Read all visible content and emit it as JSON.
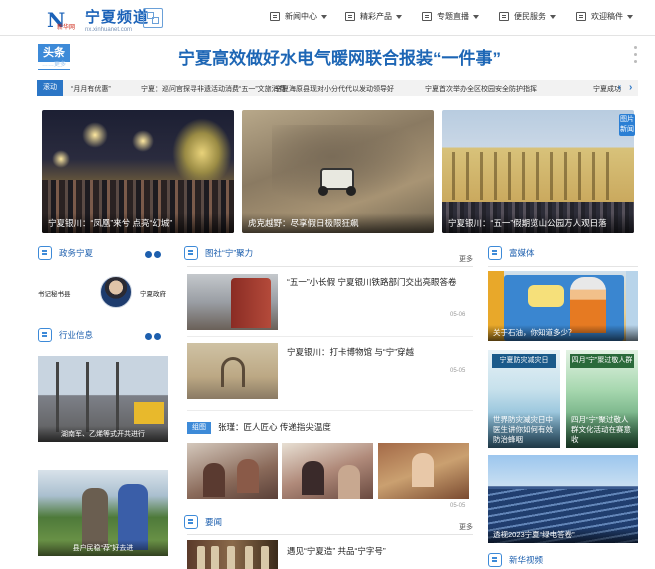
{
  "header": {
    "logo_mark": "N",
    "logo_sub": "新华网",
    "logo_title": "宁夏频道",
    "logo_url": "nx.xinhuanet.com",
    "nav": [
      {
        "label": "新闻中心"
      },
      {
        "label": "精彩产品"
      },
      {
        "label": "专题直播"
      },
      {
        "label": "便民服务"
      },
      {
        "label": "欢迎稿件"
      }
    ]
  },
  "headline": {
    "tag": "头条",
    "tag_more": "……更多",
    "title": "宁夏高效做好水电气暖网联合报装“一件事”"
  },
  "ticker": {
    "label": "滚动",
    "items": [
      "“月月有优惠”",
      "宁夏：巡问官探寻非遗活动消费“五一”文旅消费",
      "宁夏海原县现对小分代代以发动领导好",
      "宁夏首届民营企业家“感恩年”",
      "宁夏首次举办全区校园安全防护指挥",
      "宁夏成功"
    ]
  },
  "hero": [
    {
      "caption": "宁夏银川：“凤凰”来兮 点亮“幻城”"
    },
    {
      "caption": "虎克越野：尽享假日极限狂飙"
    },
    {
      "caption": "宁夏银川：“五一”假期览山公园万人观日落"
    }
  ],
  "hero_badge": "图片\n新闻",
  "left": {
    "sec1": "政务宁夏",
    "lead_left": "书记秘书县",
    "lead_right": "宁夏政府",
    "sec2": "行业信息",
    "thumb1_caption": "湖南军、乙烯等式开共进行",
    "thumb2_caption": "县户民稳“荐”好去进"
  },
  "middle": {
    "sec1": "图社“宁”聚力",
    "more": "更多",
    "news": [
      {
        "title": "“五一”小长假 宁夏银川铁路部门交出亮眼答卷",
        "date": "05-06"
      },
      {
        "title": "宁夏银川：打卡博物馆 与“宁”穿越",
        "date": "05-05"
      }
    ],
    "gallery_tag": "组图",
    "gallery_title": "张瑾：匠人匠心 传递指尖温度",
    "gallery_date": "05-05",
    "sec2": "要闻",
    "more2": "更多",
    "news3": "遇见“宁夏造” 共品“宁字号”"
  },
  "right": {
    "sec1": "富媒体",
    "big_caption": "关于石油，你知道多少？",
    "sm1_head": "宁夏防灾减灾日",
    "sm1_caption": "世界防灾减灾日中医生讲你如何有效防治蜂咽",
    "sm2_head": "四月“宁”聚过敬人群",
    "sm2_caption": "四月“宁”聚过敬人群文化活动在赛意收",
    "solar_caption": "透视2023宁夏“绿电答卷”",
    "sec2": "新华视频"
  }
}
